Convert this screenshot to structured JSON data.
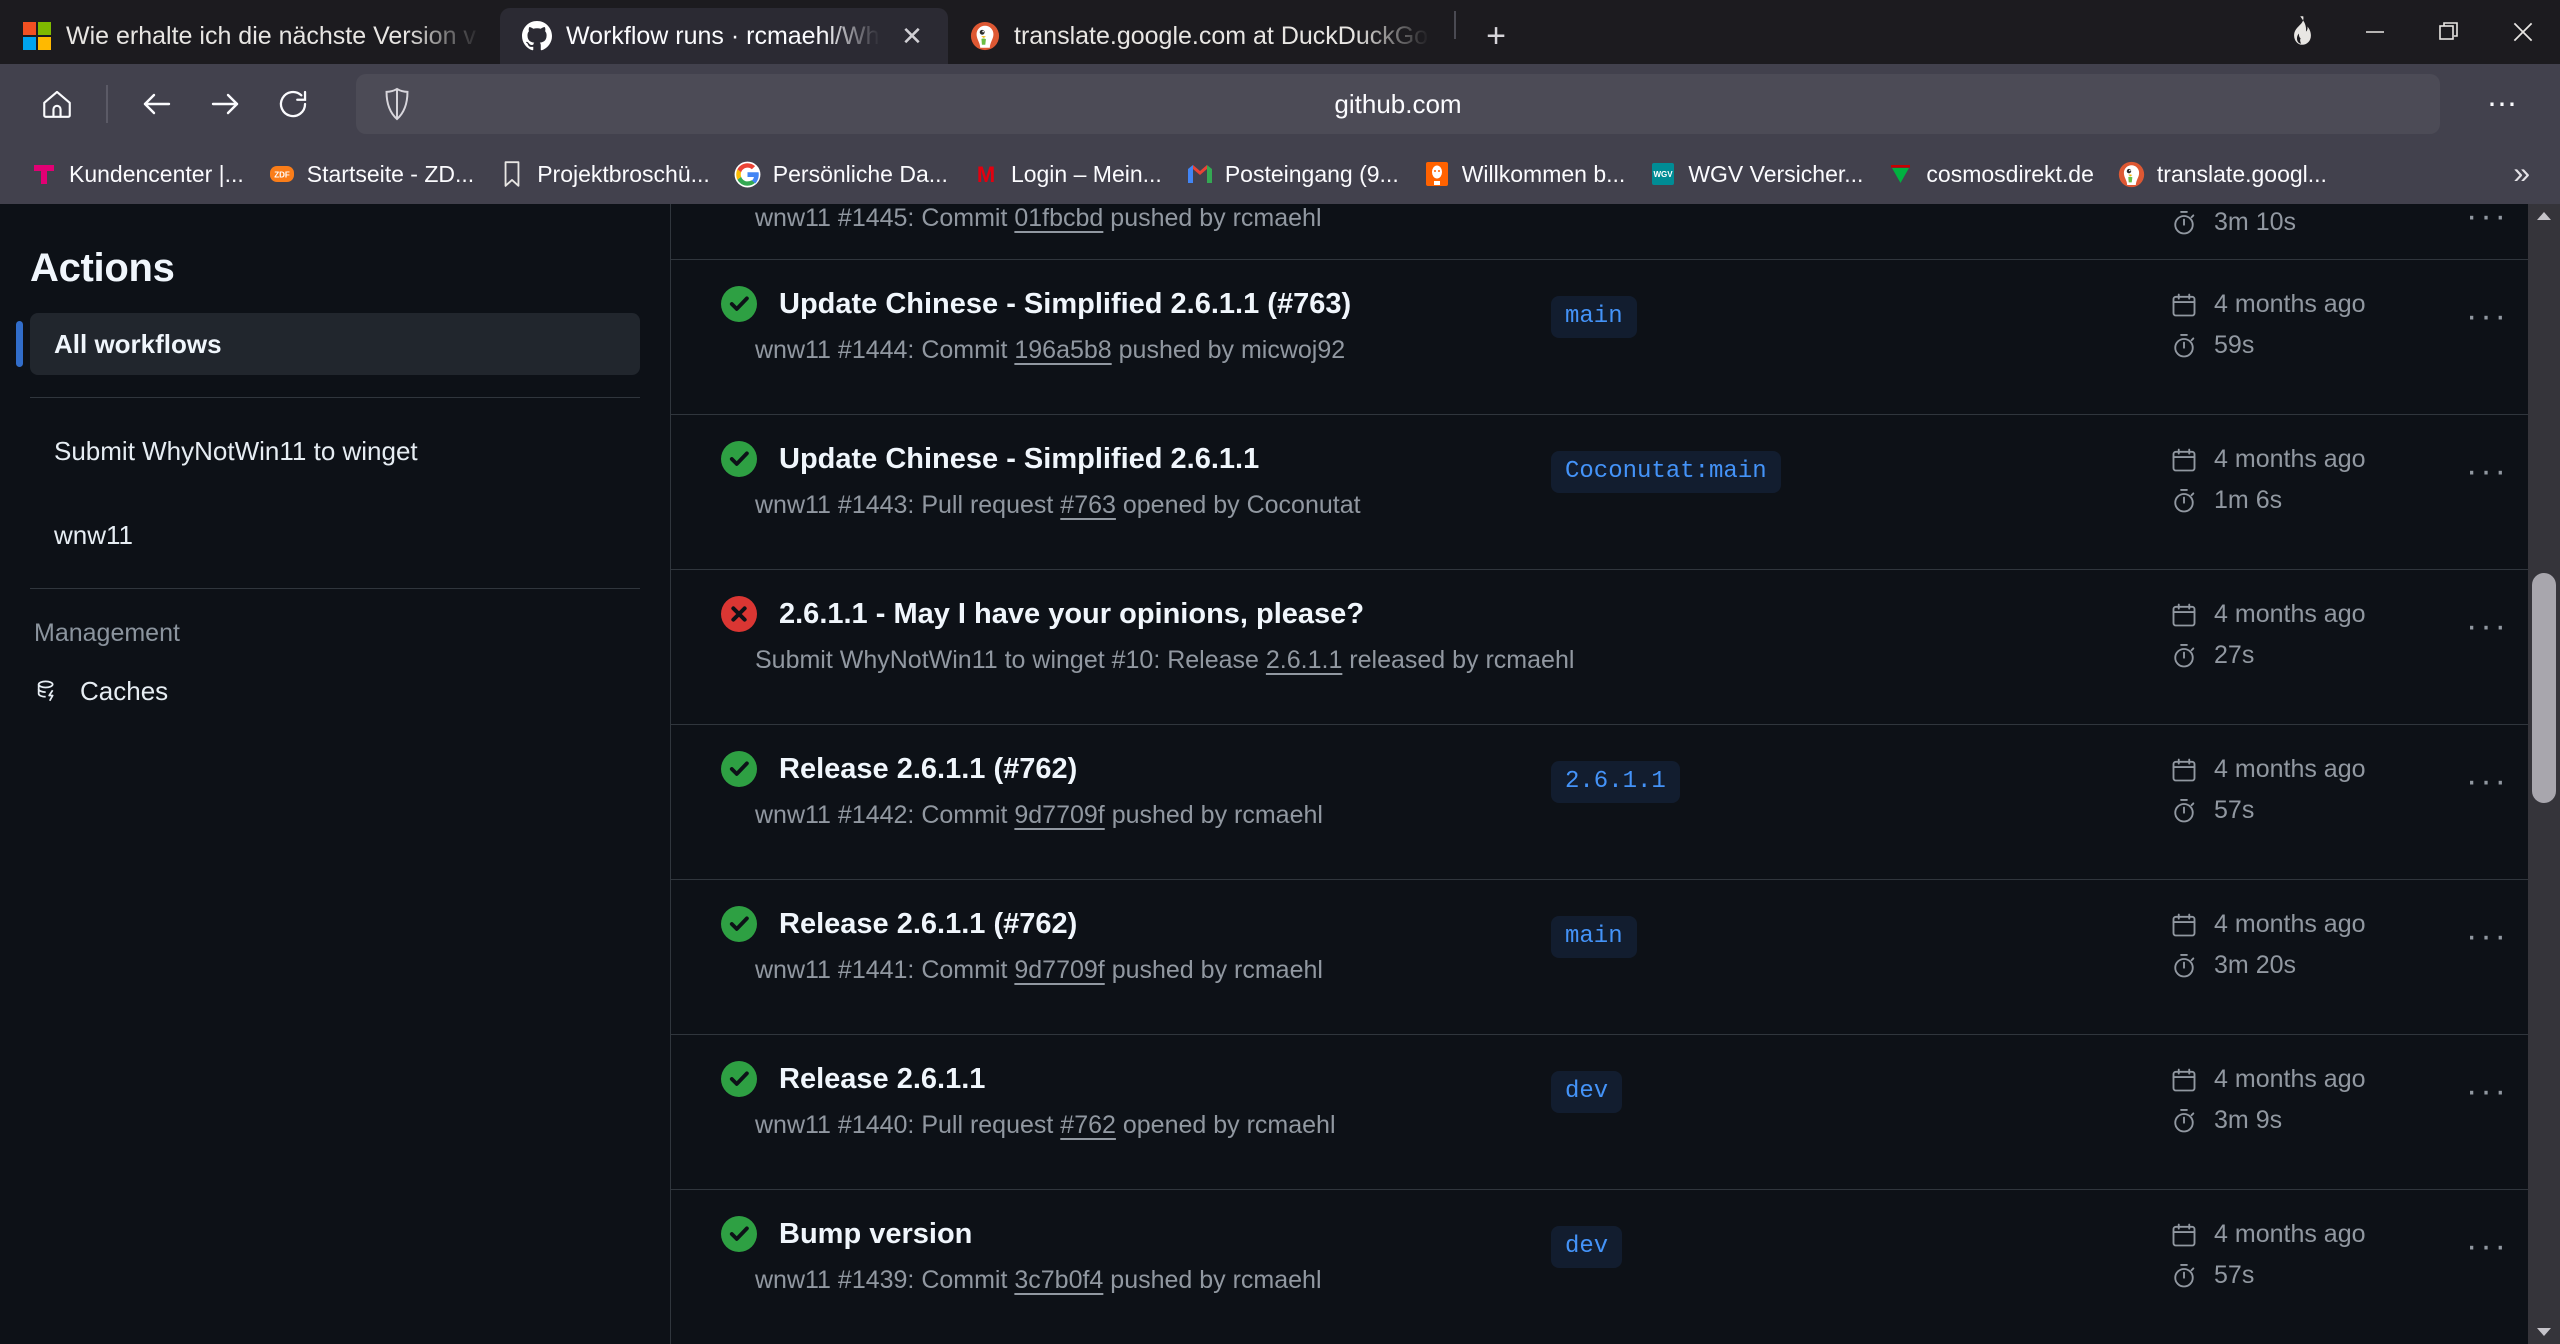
{
  "browser": {
    "tabs": [
      {
        "title": "Wie erhalte ich die nächste Version v",
        "favicon": "microsoft-icon",
        "active": false
      },
      {
        "title": "Workflow runs · rcmaehl/WhyNot",
        "favicon": "github-icon",
        "active": true
      },
      {
        "title": "translate.google.com at DuckDuckGo",
        "favicon": "duckduckgo-icon",
        "active": false
      }
    ],
    "new_tab_label": "+",
    "close_label": "✕",
    "url": "github.com",
    "window_controls": {
      "minimize": "—",
      "maximize": "❐",
      "close": "✕",
      "extension": "flame-icon"
    },
    "nav": {
      "home": "home-icon",
      "back": "back-arrow-icon",
      "forward": "forward-arrow-icon",
      "reload": "reload-icon"
    },
    "toolbar_menu": "⋯",
    "bookmarks": [
      {
        "label": "Kundencenter |...",
        "icon": "telekom-icon"
      },
      {
        "label": "Startseite - ZD...",
        "icon": "zdf-icon"
      },
      {
        "label": "Projektbroschü...",
        "icon": "bookmark-icon"
      },
      {
        "label": "Persönliche Da...",
        "icon": "google-icon"
      },
      {
        "label": "Login – Mein...",
        "icon": "m-red-icon"
      },
      {
        "label": "Posteingang (9...",
        "icon": "gmail-icon"
      },
      {
        "label": "Willkommen b...",
        "icon": "ing-lion-icon"
      },
      {
        "label": "WGV Versicher...",
        "icon": "wgv-icon"
      },
      {
        "label": "cosmosdirekt.de",
        "icon": "cosmosdirekt-icon"
      },
      {
        "label": "translate.googl...",
        "icon": "duckduckgo-icon"
      }
    ],
    "bookmarks_overflow": "»"
  },
  "sidebar": {
    "title": "Actions",
    "items": [
      {
        "label": "All workflows",
        "selected": true
      },
      {
        "label": "Submit WhyNotWin11 to winget",
        "selected": false
      },
      {
        "label": "wnw11",
        "selected": false
      }
    ],
    "management_label": "Management",
    "management_items": [
      {
        "label": "Caches",
        "icon": "cache-icon"
      }
    ]
  },
  "runs": [
    {
      "status": "partial-top",
      "title": "",
      "subtitle_prefix": "wnw11 #1445: Commit ",
      "subtitle_link": "01fbcbd",
      "subtitle_suffix": " pushed by rcmaehl",
      "branch": "",
      "age": "",
      "duration": "3m 10s",
      "kebab": "···"
    },
    {
      "status": "success",
      "title": "Update Chinese - Simplified 2.6.1.1 (#763)",
      "subtitle_prefix": "wnw11 #1444: Commit ",
      "subtitle_link": "196a5b8",
      "subtitle_suffix": " pushed by micwoj92",
      "branch": "main",
      "age": "4 months ago",
      "duration": "59s",
      "kebab": "···"
    },
    {
      "status": "success",
      "title": "Update Chinese - Simplified 2.6.1.1",
      "subtitle_prefix": "wnw11 #1443: Pull request ",
      "subtitle_link": "#763",
      "subtitle_suffix": " opened by Coconutat",
      "branch": "Coconutat:main",
      "age": "4 months ago",
      "duration": "1m 6s",
      "kebab": "···"
    },
    {
      "status": "failure",
      "title": "2.6.1.1 - May I have your opinions, please?",
      "subtitle_prefix": "Submit WhyNotWin11 to winget #10: Release ",
      "subtitle_link": "2.6.1.1",
      "subtitle_suffix": " released by rcmaehl",
      "branch": "",
      "age": "4 months ago",
      "duration": "27s",
      "kebab": "···"
    },
    {
      "status": "success",
      "title": "Release 2.6.1.1 (#762)",
      "subtitle_prefix": "wnw11 #1442: Commit ",
      "subtitle_link": "9d7709f",
      "subtitle_suffix": " pushed by rcmaehl",
      "branch": "2.6.1.1",
      "age": "4 months ago",
      "duration": "57s",
      "kebab": "···"
    },
    {
      "status": "success",
      "title": "Release 2.6.1.1 (#762)",
      "subtitle_prefix": "wnw11 #1441: Commit ",
      "subtitle_link": "9d7709f",
      "subtitle_suffix": " pushed by rcmaehl",
      "branch": "main",
      "age": "4 months ago",
      "duration": "3m 20s",
      "kebab": "···"
    },
    {
      "status": "success",
      "title": "Release 2.6.1.1",
      "subtitle_prefix": "wnw11 #1440: Pull request ",
      "subtitle_link": "#762",
      "subtitle_suffix": " opened by rcmaehl",
      "branch": "dev",
      "age": "4 months ago",
      "duration": "3m 9s",
      "kebab": "···"
    },
    {
      "status": "success",
      "title": "Bump version",
      "subtitle_prefix": "wnw11 #1439: Commit ",
      "subtitle_link": "3c7b0f4",
      "subtitle_suffix": " pushed by rcmaehl",
      "branch": "dev",
      "age": "4 months ago",
      "duration": "57s",
      "kebab": "···"
    }
  ],
  "colors": {
    "success": "#2ea043",
    "failure": "#da3633",
    "accent": "#316dca",
    "link": "#4493f8",
    "page_bg": "#0d1117",
    "border": "#30363d"
  }
}
